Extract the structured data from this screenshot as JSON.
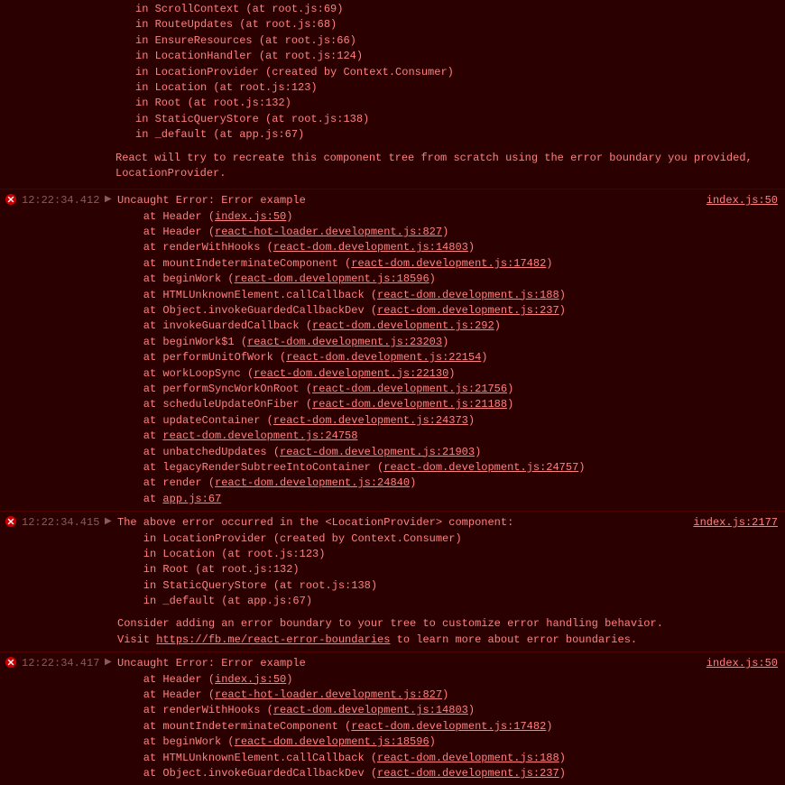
{
  "pre_trace": {
    "lines": [
      "in ScrollContext (at root.js:69)",
      "in RouteUpdates (at root.js:68)",
      "in EnsureResources (at root.js:66)",
      "in LocationHandler (at root.js:124)",
      "in LocationProvider (created by Context.Consumer)",
      "in Location (at root.js:123)",
      "in Root (at root.js:132)",
      "in StaticQueryStore (at root.js:138)",
      "in _default (at app.js:67)"
    ],
    "footer": "React will try to recreate this component tree from scratch using the error boundary you provided, LocationProvider."
  },
  "entries": [
    {
      "timestamp": "12:22:34.412",
      "source": "index.js:50",
      "header": "Uncaught Error: Error example",
      "frames": [
        {
          "prefix": "    at Header (",
          "link": "index.js:50",
          "suffix": ")"
        },
        {
          "prefix": "    at Header (",
          "link": "react-hot-loader.development.js:827",
          "suffix": ")"
        },
        {
          "prefix": "    at renderWithHooks (",
          "link": "react-dom.development.js:14803",
          "suffix": ")"
        },
        {
          "prefix": "    at mountIndeterminateComponent (",
          "link": "react-dom.development.js:17482",
          "suffix": ")"
        },
        {
          "prefix": "    at beginWork (",
          "link": "react-dom.development.js:18596",
          "suffix": ")"
        },
        {
          "prefix": "    at HTMLUnknownElement.callCallback (",
          "link": "react-dom.development.js:188",
          "suffix": ")"
        },
        {
          "prefix": "    at Object.invokeGuardedCallbackDev (",
          "link": "react-dom.development.js:237",
          "suffix": ")"
        },
        {
          "prefix": "    at invokeGuardedCallback (",
          "link": "react-dom.development.js:292",
          "suffix": ")"
        },
        {
          "prefix": "    at beginWork$1 (",
          "link": "react-dom.development.js:23203",
          "suffix": ")"
        },
        {
          "prefix": "    at performUnitOfWork (",
          "link": "react-dom.development.js:22154",
          "suffix": ")"
        },
        {
          "prefix": "    at workLoopSync (",
          "link": "react-dom.development.js:22130",
          "suffix": ")"
        },
        {
          "prefix": "    at performSyncWorkOnRoot (",
          "link": "react-dom.development.js:21756",
          "suffix": ")"
        },
        {
          "prefix": "    at scheduleUpdateOnFiber (",
          "link": "react-dom.development.js:21188",
          "suffix": ")"
        },
        {
          "prefix": "    at updateContainer (",
          "link": "react-dom.development.js:24373",
          "suffix": ")"
        },
        {
          "prefix": "    at ",
          "link": "react-dom.development.js:24758",
          "suffix": ""
        },
        {
          "prefix": "    at unbatchedUpdates (",
          "link": "react-dom.development.js:21903",
          "suffix": ")"
        },
        {
          "prefix": "    at legacyRenderSubtreeIntoContainer (",
          "link": "react-dom.development.js:24757",
          "suffix": ")"
        },
        {
          "prefix": "    at render (",
          "link": "react-dom.development.js:24840",
          "suffix": ")"
        },
        {
          "prefix": "    at ",
          "link": "app.js:67",
          "suffix": ""
        }
      ]
    },
    {
      "timestamp": "12:22:34.415",
      "source": "index.js:2177",
      "header": "The above error occurred in the <LocationProvider> component:",
      "plain_lines": [
        "    in LocationProvider (created by Context.Consumer)",
        "    in Location (at root.js:123)",
        "    in Root (at root.js:132)",
        "    in StaticQueryStore (at root.js:138)",
        "    in _default (at app.js:67)"
      ],
      "footer_pre": "Consider adding an error boundary to your tree to customize error handling behavior.\nVisit ",
      "footer_link": "https://fb.me/react-error-boundaries",
      "footer_post": " to learn more about error boundaries."
    },
    {
      "timestamp": "12:22:34.417",
      "source": "index.js:50",
      "header": "Uncaught Error: Error example",
      "frames": [
        {
          "prefix": "    at Header (",
          "link": "index.js:50",
          "suffix": ")"
        },
        {
          "prefix": "    at Header (",
          "link": "react-hot-loader.development.js:827",
          "suffix": ")"
        },
        {
          "prefix": "    at renderWithHooks (",
          "link": "react-dom.development.js:14803",
          "suffix": ")"
        },
        {
          "prefix": "    at mountIndeterminateComponent (",
          "link": "react-dom.development.js:17482",
          "suffix": ")"
        },
        {
          "prefix": "    at beginWork (",
          "link": "react-dom.development.js:18596",
          "suffix": ")"
        },
        {
          "prefix": "    at HTMLUnknownElement.callCallback (",
          "link": "react-dom.development.js:188",
          "suffix": ")"
        },
        {
          "prefix": "    at Object.invokeGuardedCallbackDev (",
          "link": "react-dom.development.js:237",
          "suffix": ")"
        }
      ]
    }
  ]
}
